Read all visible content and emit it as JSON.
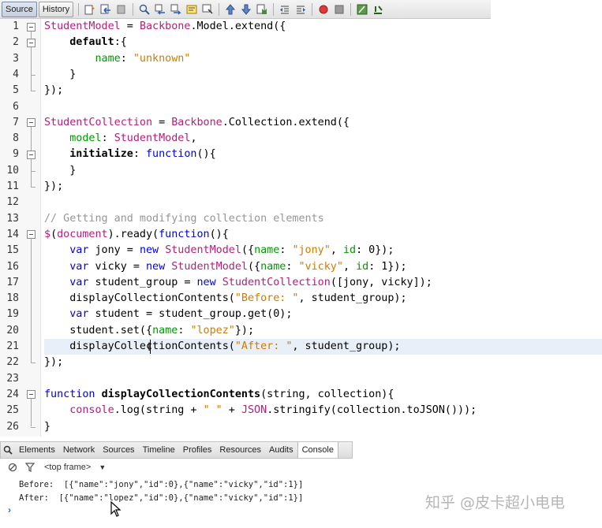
{
  "toolbar": {
    "tabs": [
      "Source",
      "History"
    ],
    "buttons": [
      "last-edit-icon",
      "back-icon",
      "forward-icon",
      "find-icon",
      "find-previous-icon",
      "find-next-icon",
      "highlight-icon",
      "toggle-selection-icon",
      "previous-bookmark-icon",
      "next-bookmark-icon",
      "toggle-bookmark-icon",
      "shift-left-icon",
      "shift-right-icon",
      "record-macro-icon",
      "stop-macro-icon",
      "comment-icon",
      "uncomment-icon"
    ]
  },
  "editor": {
    "current_line": 21,
    "lines": [
      {
        "n": "1"
      },
      {
        "n": "2"
      },
      {
        "n": "3"
      },
      {
        "n": "4"
      },
      {
        "n": "5"
      },
      {
        "n": "6"
      },
      {
        "n": "7"
      },
      {
        "n": "8"
      },
      {
        "n": "9"
      },
      {
        "n": "10"
      },
      {
        "n": "11"
      },
      {
        "n": "12"
      },
      {
        "n": "13"
      },
      {
        "n": "14"
      },
      {
        "n": "15"
      },
      {
        "n": "16"
      },
      {
        "n": "17"
      },
      {
        "n": "18"
      },
      {
        "n": "19"
      },
      {
        "n": "20"
      },
      {
        "n": "21"
      },
      {
        "n": "22"
      },
      {
        "n": "23"
      },
      {
        "n": "24"
      },
      {
        "n": "25"
      },
      {
        "n": "26"
      }
    ],
    "code": {
      "l1": {
        "a": "StudentModel",
        "b": " = ",
        "c": "Backbone",
        "d": ".Model.extend({"
      },
      "l2": {
        "a": "default",
        "b": ":{"
      },
      "l3": {
        "a": "name",
        "b": ": ",
        "c": "\"unknown\""
      },
      "l4": {
        "a": "}"
      },
      "l5": {
        "a": "});"
      },
      "l7": {
        "a": "StudentCollection",
        "b": " = ",
        "c": "Backbone",
        "d": ".Collection.extend({"
      },
      "l8": {
        "a": "model",
        "b": ": ",
        "c": "StudentModel",
        "d": ","
      },
      "l9": {
        "a": "initialize",
        "b": ": ",
        "c": "function",
        "d": "(){"
      },
      "l10": {
        "a": "}"
      },
      "l11": {
        "a": "});"
      },
      "l13": {
        "a": "// Getting and modifying collection elements"
      },
      "l14": {
        "a": "$",
        "b": "(",
        "c": "document",
        "d": ").ready(",
        "e": "function",
        "f": "(){"
      },
      "l15": {
        "a": "var",
        "b": " jony = ",
        "c": "new",
        "d": " ",
        "e": "StudentModel",
        "f": "({",
        "g": "name",
        "h": ": ",
        "i": "\"jony\"",
        "j": ", ",
        "k": "id",
        "l": ": 0});"
      },
      "l16": {
        "a": "var",
        "b": " vicky = ",
        "c": "new",
        "d": " ",
        "e": "StudentModel",
        "f": "({",
        "g": "name",
        "h": ": ",
        "i": "\"vicky\"",
        "j": ", ",
        "k": "id",
        "l": ": 1});"
      },
      "l17": {
        "a": "var",
        "b": " student_group = ",
        "c": "new",
        "d": " ",
        "e": "StudentCollection",
        "f": "([jony, vicky]);"
      },
      "l18": {
        "a": "displayCollectionContents(",
        "b": "\"Before: \"",
        "c": ", student_group);"
      },
      "l19": {
        "a": "var",
        "b": " student = student_group.get(0);"
      },
      "l20": {
        "a": "student.set({",
        "b": "name",
        "c": ": ",
        "d": "\"lopez\"",
        "e": "});"
      },
      "l21": {
        "a": "displayCollectionContents(",
        "b": "\"After: \"",
        "c": ", student_group);"
      },
      "l22": {
        "a": "});"
      },
      "l24": {
        "a": "function",
        "b": " ",
        "c": "displayCollectionContents",
        "d": "(string, collection){"
      },
      "l25": {
        "a": "console",
        "b": ".log(string + ",
        "c": "\" \"",
        "d": " + ",
        "e": "JSON",
        "f": ".stringify(collection.toJSON()));"
      },
      "l26": {
        "a": "}"
      }
    }
  },
  "devtools": {
    "tabs": [
      "Elements",
      "Network",
      "Sources",
      "Timeline",
      "Profiles",
      "Resources",
      "Audits",
      "Console"
    ],
    "active_tab": "Console",
    "frame_selector": "<top frame>",
    "console_lines": [
      "Before:  [{\"name\":\"jony\",\"id\":0},{\"name\":\"vicky\",\"id\":1}]",
      "After:  [{\"name\":\"lopez\",\"id\":0},{\"name\":\"vicky\",\"id\":1}]"
    ],
    "prompt": "›"
  },
  "watermark": "知乎 @皮卡超小电电",
  "colors": {
    "keyword": "#0000e6",
    "class_name": "#b41e78",
    "string": "#ce7b00",
    "property": "#009900",
    "comment": "#969696",
    "current_line": "#e9eff8"
  }
}
